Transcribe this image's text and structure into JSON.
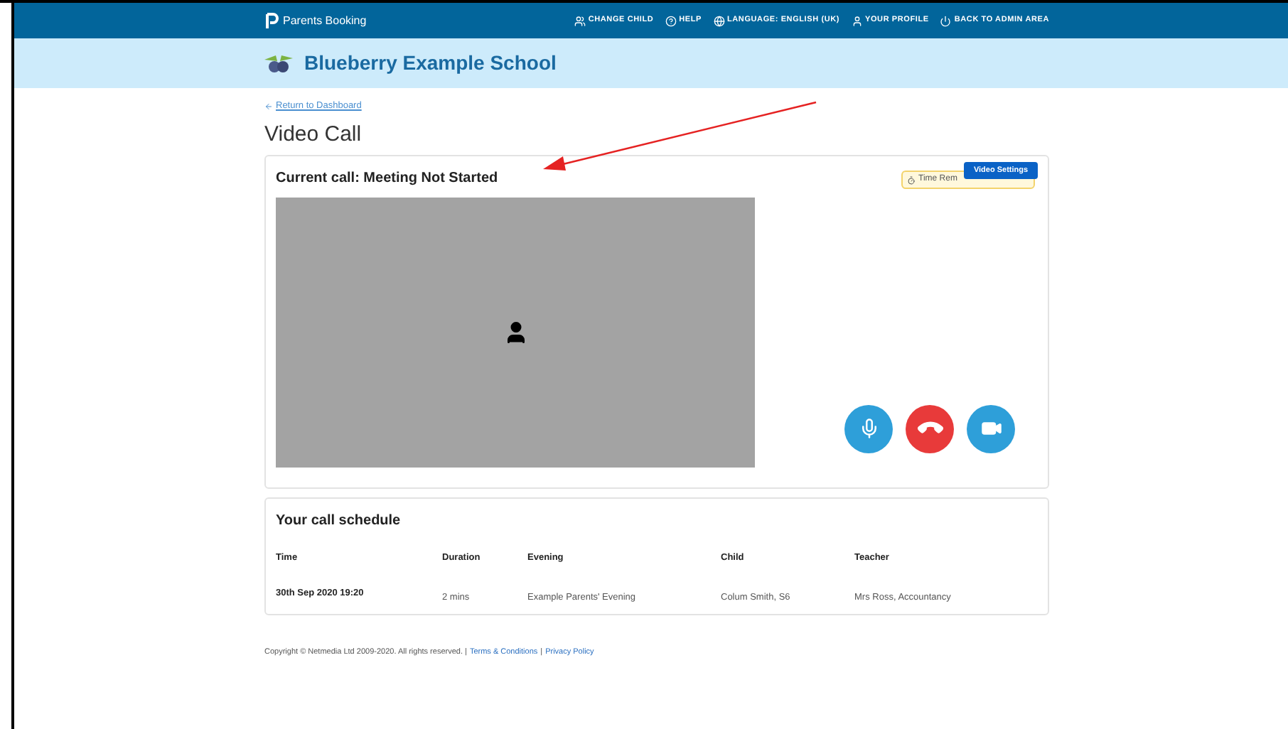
{
  "navbar": {
    "brand": "Parents Booking",
    "links": [
      {
        "kind": "child",
        "label": "CHANGE CHILD"
      },
      {
        "kind": "help",
        "label": "HELP"
      },
      {
        "kind": "language",
        "label": "LANGUAGE: ENGLISH (UK)"
      },
      {
        "kind": "profile",
        "label": "YOUR PROFILE"
      },
      {
        "kind": "admin",
        "label": "BACK TO ADMIN AREA"
      }
    ]
  },
  "school_banner": {
    "name": "Blueberry Example School"
  },
  "back_link": "Return to Dashboard",
  "page_title": "Video Call",
  "call_card": {
    "title": "Current call: Meeting Not Started",
    "timer_badge": "Time Rem",
    "settings_button": "Video Settings",
    "controls": [
      {
        "kind": "mic"
      },
      {
        "kind": "hangup"
      },
      {
        "kind": "camera"
      }
    ]
  },
  "schedule": {
    "title": "Your call schedule",
    "columns": [
      "Time",
      "Duration",
      "Evening",
      "Child",
      "Teacher"
    ],
    "rows": [
      [
        "30th Sep 2020 19:20",
        "2 mins",
        "Example Parents' Evening",
        "Colum Smith, S6",
        "Mrs Ross, Accountancy"
      ]
    ]
  },
  "footer": {
    "copyright": "Copyright © Netmedia Ltd 2009-2020. All rights reserved. |",
    "links": [
      "Terms & Conditions",
      "Privacy Policy"
    ],
    "separator": "|"
  }
}
